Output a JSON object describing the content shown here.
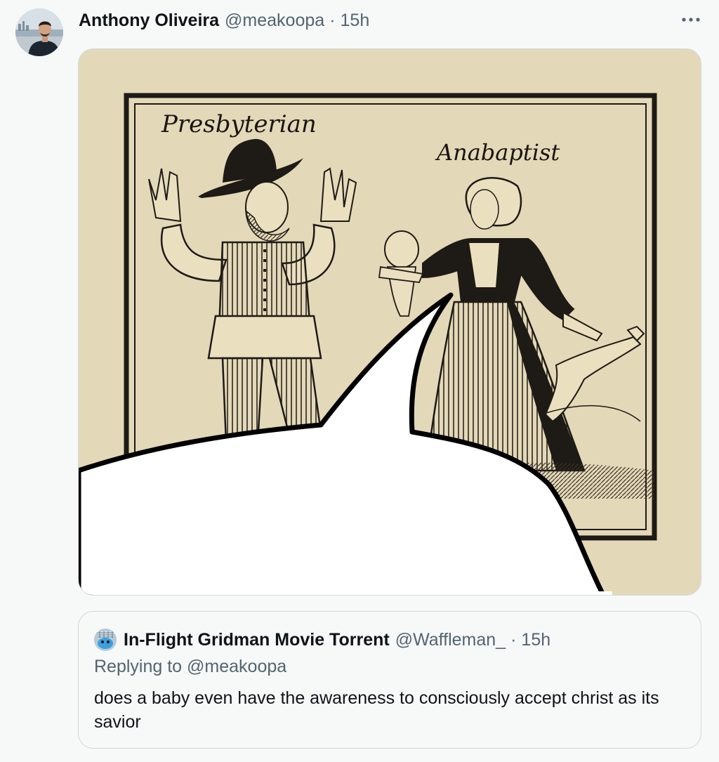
{
  "tweet": {
    "author_name": "Anthony Oliveira",
    "author_handle": "@meakoopa",
    "separator": "·",
    "time": "15h",
    "more_icon": "more-horizontal-icon",
    "media": {
      "labels": [
        "Presbyterian",
        "Anabaptist"
      ]
    }
  },
  "quote": {
    "author_name": "In-Flight Gridman Movie Torrent",
    "author_handle": "@Waffleman_",
    "separator": "·",
    "time": "15h",
    "replying_prefix": "Replying to",
    "replying_mention": "@meakoopa",
    "text": "does a baby even have the awareness to consciously accept christ as its savior"
  },
  "colors": {
    "text_primary": "#0f1419",
    "text_secondary": "#536471",
    "border": "#cfd9de",
    "background": "#f7f8f8"
  }
}
